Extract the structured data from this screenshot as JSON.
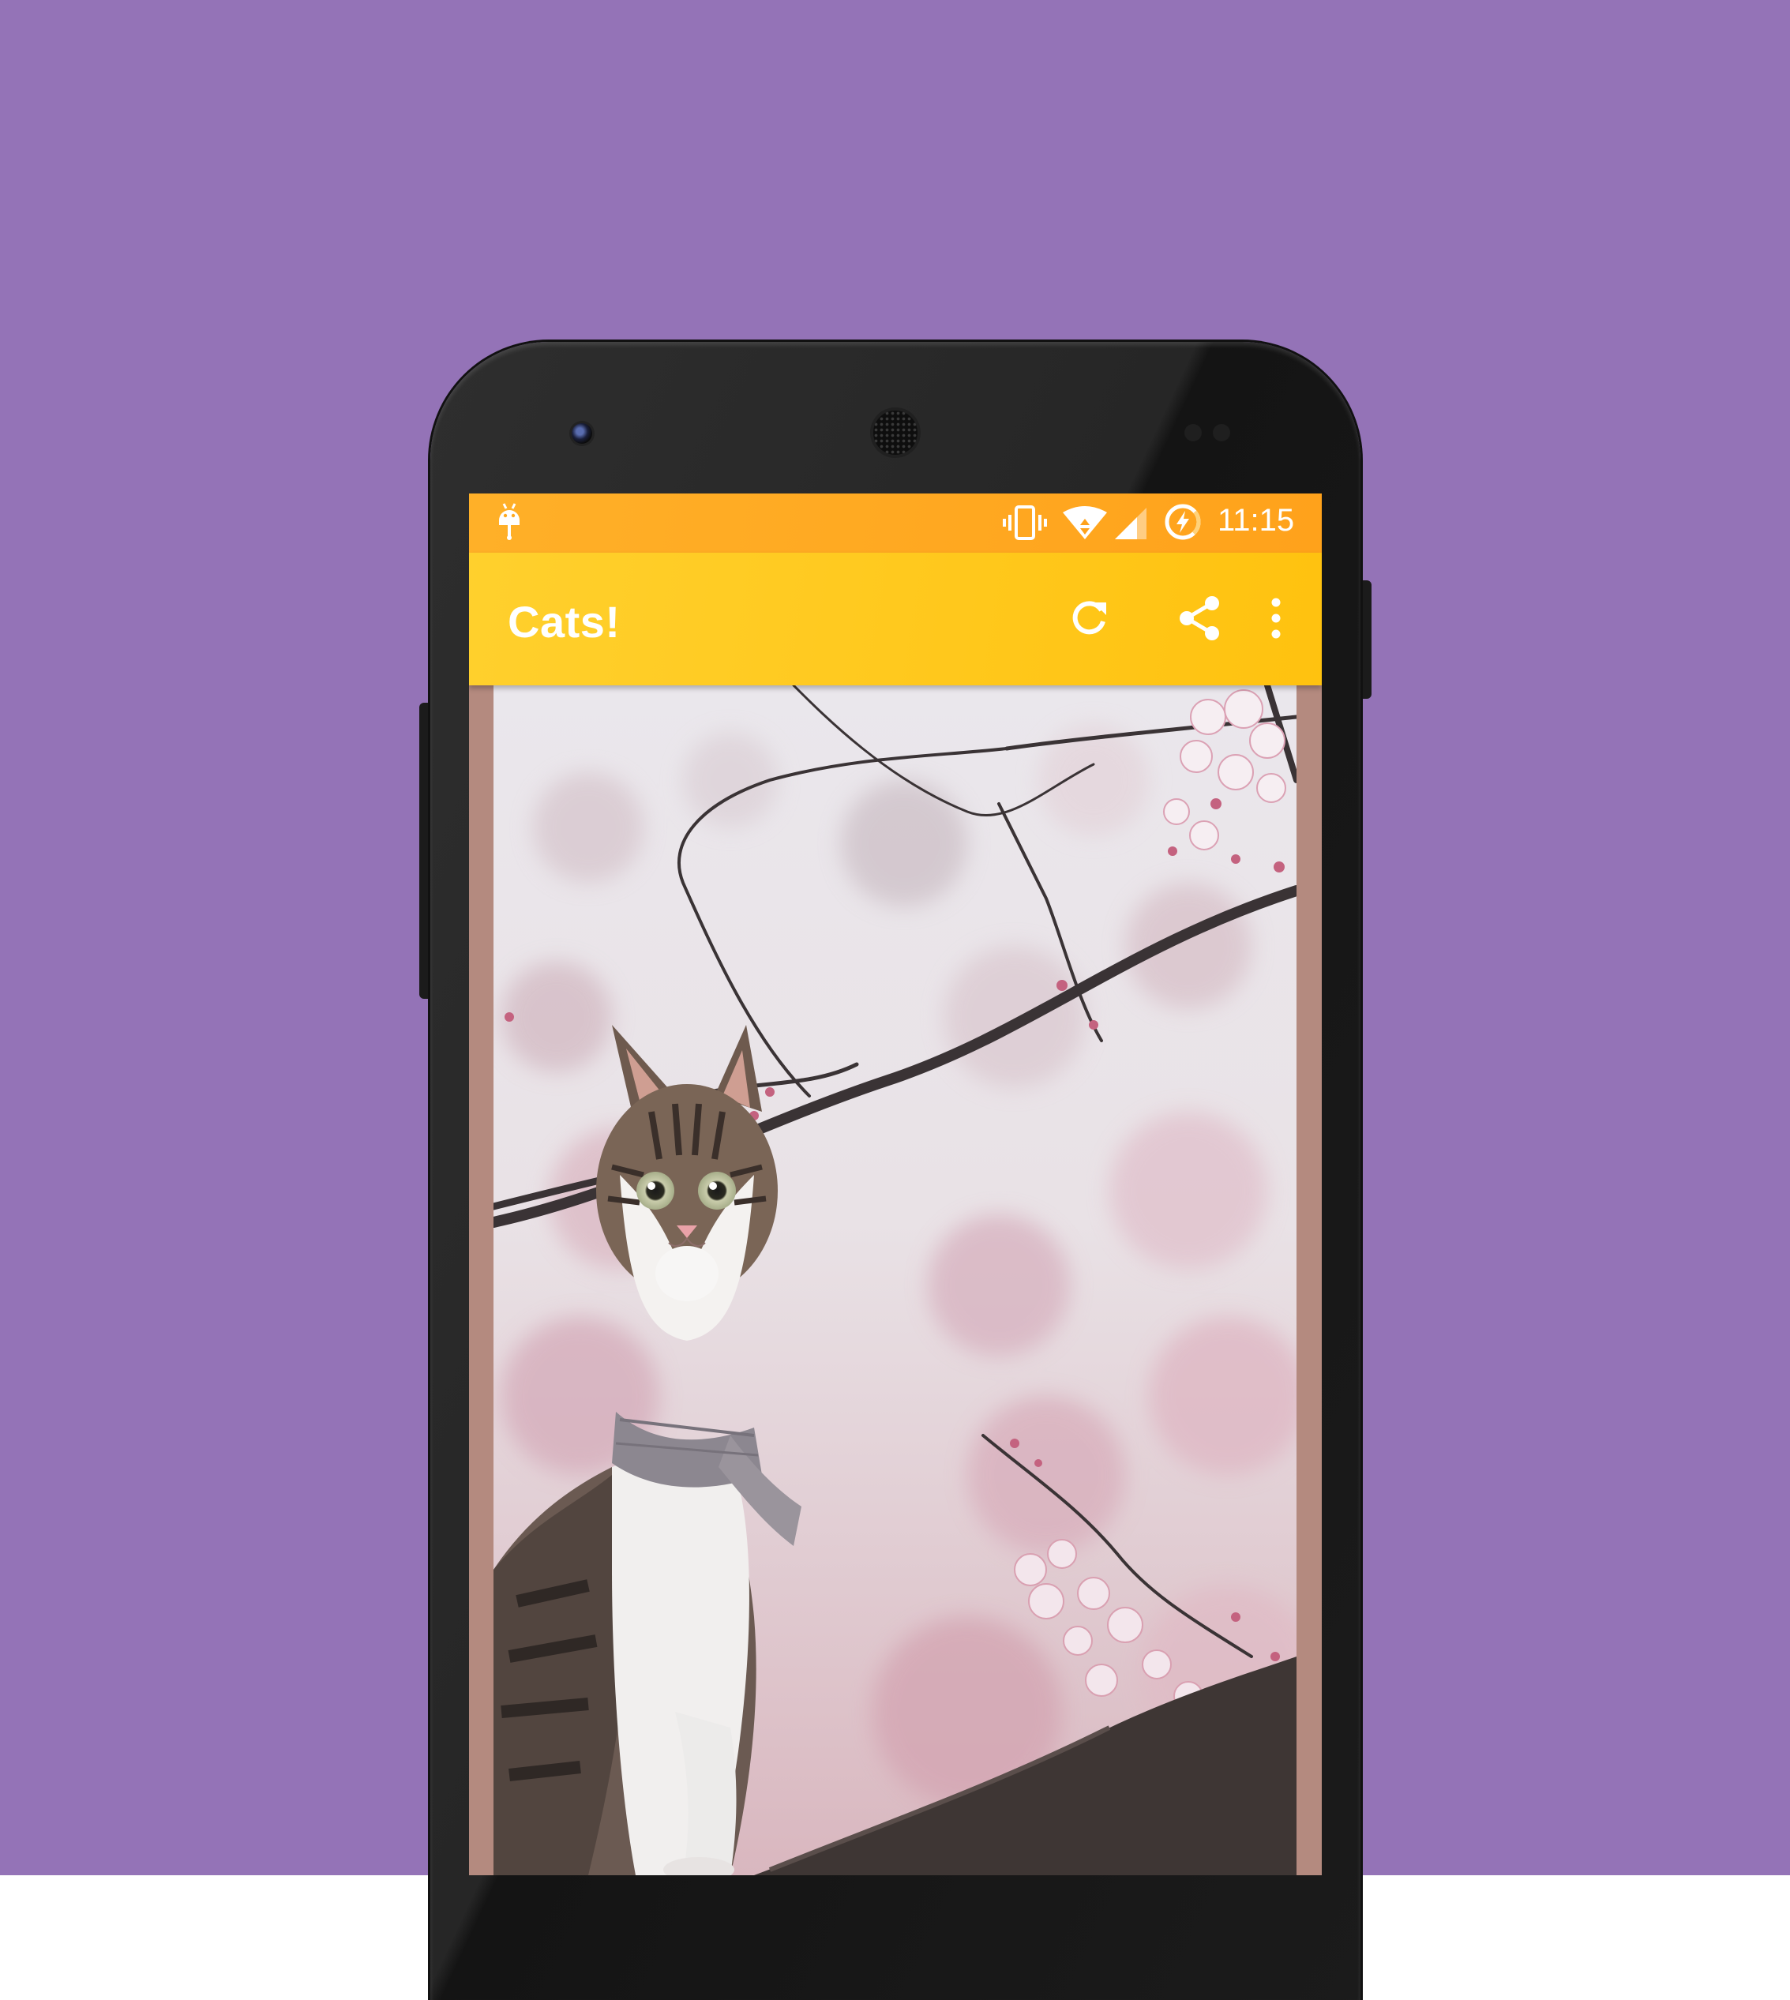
{
  "colors": {
    "background": "#9473b7",
    "status_bar": "#ffa21b",
    "app_bar": "#ffc20f",
    "photo_frame": "#b48a7f"
  },
  "status_bar": {
    "time": "11:15",
    "icons": [
      "android-notification-icon",
      "vibrate-icon",
      "wifi-icon",
      "cell-signal-icon",
      "battery-saver-icon"
    ]
  },
  "app_bar": {
    "title": "Cats!",
    "actions": [
      "refresh-icon",
      "share-icon",
      "more-vert-icon"
    ]
  },
  "content": {
    "image": "cat-photo"
  }
}
